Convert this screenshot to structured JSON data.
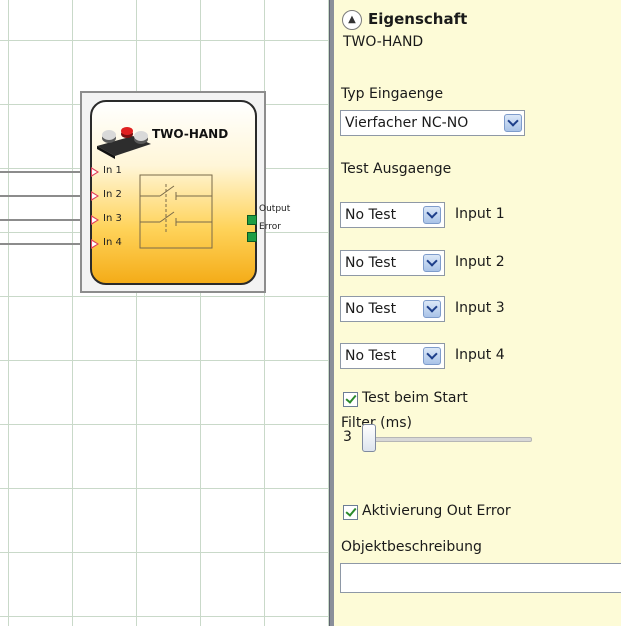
{
  "block": {
    "title": "TWO-HAND",
    "inputs": [
      "In 1",
      "In 2",
      "In 3",
      "In 4"
    ],
    "outputs": [
      "Output",
      "Error"
    ]
  },
  "panel": {
    "header": "Eigenschaft",
    "object_name": "TWO-HAND",
    "typ_label": "Typ Eingaenge",
    "typ_value": "Vierfacher NC-NO",
    "test_label": "Test Ausgaenge",
    "tests": [
      {
        "value": "No Test",
        "label": "Input 1"
      },
      {
        "value": "No Test",
        "label": "Input 2"
      },
      {
        "value": "No Test",
        "label": "Input 3"
      },
      {
        "value": "No Test",
        "label": "Input 4"
      }
    ],
    "test_start_label": "Test beim Start",
    "test_start_checked": true,
    "filter_label": "Filter (ms)",
    "filter_value": "3",
    "activation_label": "Aktivierung Out Error",
    "activation_checked": true,
    "description_label": "Objektbeschreibung",
    "description_value": ""
  },
  "colors": {
    "panel_bg": "#fdfbd7",
    "block_gradient_bottom": "#f4ac18",
    "input_arrow": "#e0405a",
    "output_port": "#1e9d45"
  },
  "icons": [
    "collapse-up-icon",
    "two-hand-buttons-icon",
    "dropdown-chevron-icon",
    "checkbox-checked-icon"
  ]
}
